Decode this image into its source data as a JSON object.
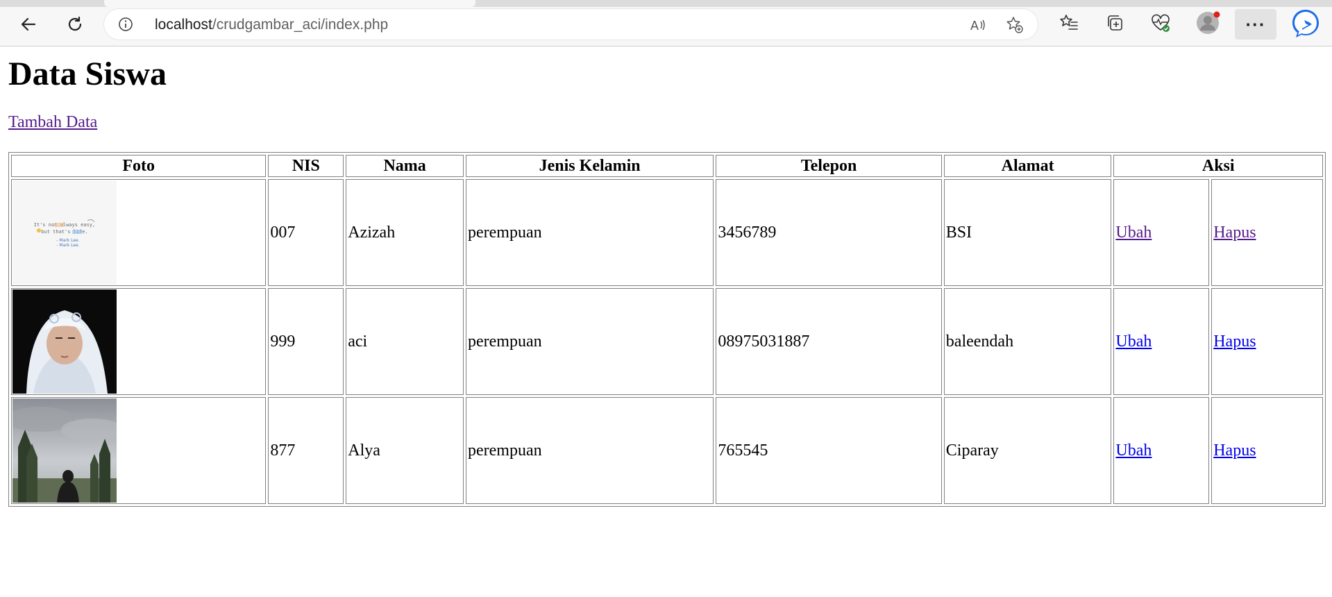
{
  "browser": {
    "url_host": "localhost",
    "url_path": "/crudgambar_aci/index.php",
    "more_label": "···"
  },
  "page": {
    "title": "Data Siswa",
    "add_link": "Tambah Data"
  },
  "table": {
    "headers": [
      "Foto",
      "NIS",
      "Nama",
      "Jenis Kelamin",
      "Telepon",
      "Alamat",
      "Aksi"
    ],
    "rows": [
      {
        "nis": "007",
        "nama": "Azizah",
        "jenis_kelamin": "perempuan",
        "telepon": "3456789",
        "alamat": "BSI",
        "ubah": "Ubah",
        "hapus": "Hapus",
        "photo": "quote-card",
        "photo_text": "It's not always easy, but that's life. - Mark Lee."
      },
      {
        "nis": "999",
        "nama": "aci",
        "jenis_kelamin": "perempuan",
        "telepon": "08975031887",
        "alamat": "baleendah",
        "ubah": "Ubah",
        "hapus": "Hapus",
        "photo": "portrait"
      },
      {
        "nis": "877",
        "nama": "Alya",
        "jenis_kelamin": "perempuan",
        "telepon": "765545",
        "alamat": "Ciparay",
        "ubah": "Ubah",
        "hapus": "Hapus",
        "photo": "landscape"
      }
    ]
  },
  "colors": {
    "visited_link": "#551a8b",
    "unvisited_link": "#0000ee",
    "border": "#808080"
  }
}
